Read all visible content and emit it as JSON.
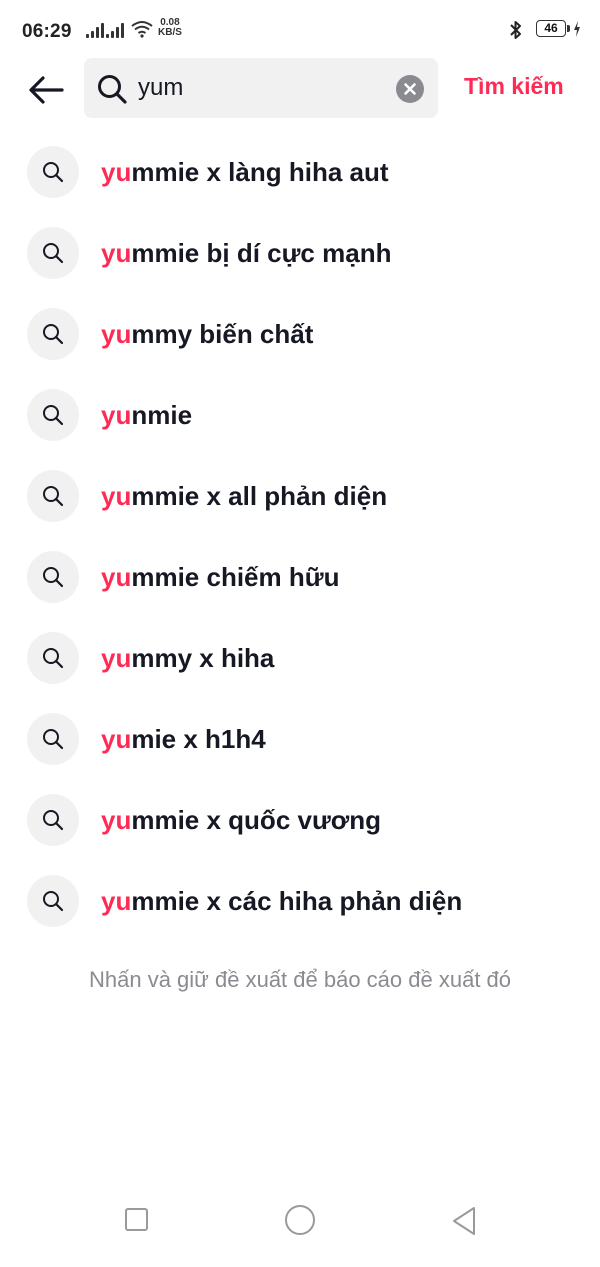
{
  "status_bar": {
    "time": "06:29",
    "net_speed_value": "0.08",
    "net_speed_unit": "KB/S",
    "battery": "46",
    "icons": [
      "signal-icon",
      "wifi-icon",
      "bluetooth-icon",
      "battery-icon",
      "charging-icon"
    ]
  },
  "header": {
    "back_icon": "arrow-left-icon",
    "search_query": "yum",
    "search_button_label": "Tìm kiếm",
    "clear_icon": "clear-icon"
  },
  "suggestions": [
    {
      "highlight": "yu",
      "rest": "mmie x làng hiha aut"
    },
    {
      "highlight": "yu",
      "rest": "mmie bị dí cực mạnh"
    },
    {
      "highlight": "yu",
      "rest": "mmy biến chất"
    },
    {
      "highlight": "yu",
      "rest": "nmie"
    },
    {
      "highlight": "yu",
      "rest": "mmie x all phản diện"
    },
    {
      "highlight": "yu",
      "rest": "mmie chiếm hữu"
    },
    {
      "highlight": "yu",
      "rest": "mmy x hiha"
    },
    {
      "highlight": "yu",
      "rest": "mie x h1h4"
    },
    {
      "highlight": "yu",
      "rest": "mmie x quốc vương"
    },
    {
      "highlight": "yu",
      "rest": "mmie x các hiha phản diện"
    }
  ],
  "hint_text": "Nhấn và giữ đề xuất để báo cáo đề xuất đó",
  "colors": {
    "accent": "#fe2c55",
    "text": "#161823",
    "muted": "#8a8b91",
    "search_bg": "#f1f1f2"
  },
  "nav_bar": {
    "icons": [
      "recent-apps-icon",
      "home-icon",
      "back-icon"
    ]
  }
}
